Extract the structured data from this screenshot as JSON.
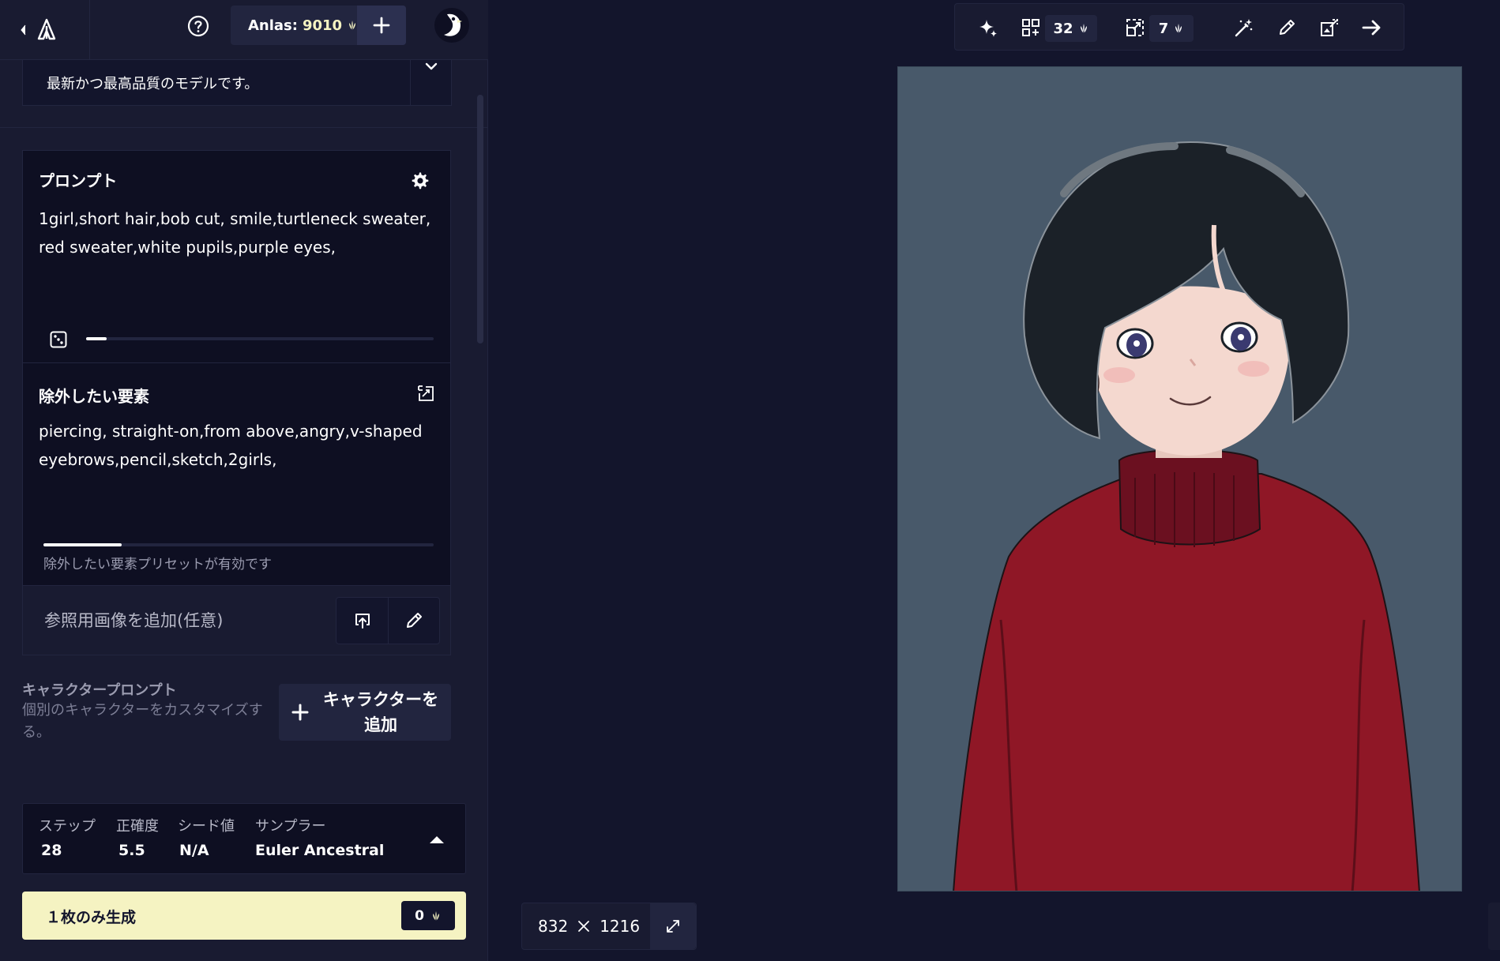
{
  "topbar": {
    "back_icon": "chevron-left-icon",
    "logo_icon": "novelai-logo-icon",
    "help_icon": "help-circle-icon",
    "anlas_label": "Anlas:",
    "anlas_value": "9010",
    "anlas_icon": "anlas-icon",
    "add_icon": "plus-icon",
    "avatar_icon": "penguin-avatar-icon"
  },
  "model": {
    "description": "最新かつ最高品質のモデルです。",
    "toggle_icon": "chevron-down-icon"
  },
  "prompt": {
    "title": "プロンプト",
    "settings_icon": "gear-icon",
    "text": "1girl,short hair,bob cut, smile,turtleneck sweater, red sweater,white pupils,purple eyes,",
    "dice_icon": "dice-icon",
    "token_fill_fraction": 0.06
  },
  "negative": {
    "title": "除外したい要素",
    "swap_icon": "swap-icon",
    "text": "piercing, straight-on,from above,angry,v-shaped eyebrows,pencil,sketch,2girls,",
    "token_fill_fraction": 0.2,
    "note": "除外したい要素プリセットが有効です"
  },
  "reference": {
    "label": "参照用画像を追加(任意)",
    "upload_icon": "upload-icon",
    "paint_icon": "brush-icon"
  },
  "character": {
    "title": "キャラクタープロンプト",
    "description": "個別のキャラクターをカスタマイズする。",
    "add_label_line1": "キャラクターを",
    "add_label_line2": "追加",
    "add_icon": "plus-icon"
  },
  "params": {
    "steps_label": "ステップ",
    "steps_value": "28",
    "guidance_label": "正確度",
    "guidance_value": "5.5",
    "seed_label": "シード値",
    "seed_value": "N/A",
    "sampler_label": "サンプラー",
    "sampler_value": "Euler Ancestral",
    "toggle_icon": "chevron-up-icon"
  },
  "generate": {
    "label": "１枚のみ生成",
    "cost": "0",
    "cost_icon": "anlas-icon"
  },
  "toolbar": {
    "enhance_icon": "sparkle-icon",
    "variations_icon": "variations-icon",
    "variations_cost": "32",
    "upscale_icon": "upscale-icon",
    "upscale_cost": "7",
    "magic_icon": "magic-wand-icon",
    "inpaint_icon": "pencil-icon",
    "img2img_icon": "image-edit-icon",
    "next_icon": "arrow-right-icon"
  },
  "canvas": {
    "width": "832",
    "height": "1216",
    "times_icon": "times-icon",
    "expand_icon": "expand-icon",
    "image_subject": "generated-anime-portrait"
  },
  "colors": {
    "background": "#13152c",
    "panel": "#191b31",
    "card": "#0e0f22",
    "accent": "#f5f3c2"
  }
}
